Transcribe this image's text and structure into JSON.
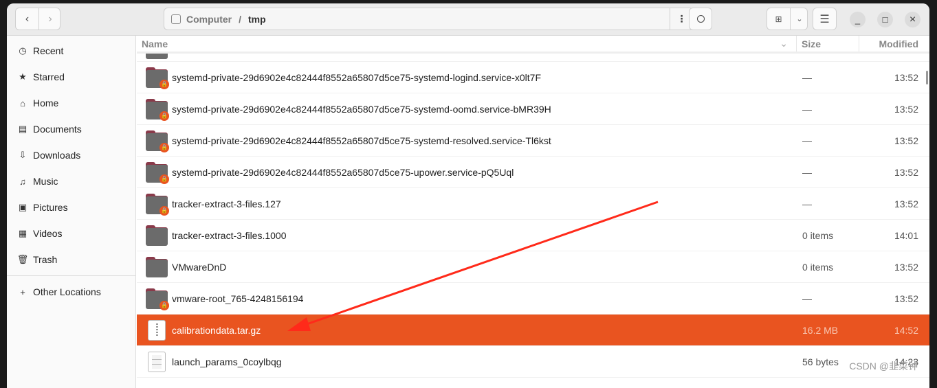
{
  "toolbar": {
    "back_icon": "chevron-left",
    "forward_icon": "chevron-right",
    "path": {
      "root": "Computer",
      "sep": "/",
      "current": "tmp"
    },
    "menu_dots": "⋮",
    "search_icon": "search",
    "view_icon": "grid",
    "view_dropdown": "chevron-down",
    "menu_icon": "hamburger",
    "minimize": "_",
    "maximize": "□",
    "close": "×"
  },
  "sidebar": {
    "items": [
      {
        "icon": "clock",
        "glyph": "◷",
        "label": "Recent"
      },
      {
        "icon": "star",
        "glyph": "★",
        "label": "Starred"
      },
      {
        "icon": "home",
        "glyph": "⌂",
        "label": "Home"
      },
      {
        "icon": "document",
        "glyph": "▤",
        "label": "Documents"
      },
      {
        "icon": "download",
        "glyph": "⇩",
        "label": "Downloads"
      },
      {
        "icon": "music",
        "glyph": "♫",
        "label": "Music"
      },
      {
        "icon": "picture",
        "glyph": "▣",
        "label": "Pictures"
      },
      {
        "icon": "video",
        "glyph": "▦",
        "label": "Videos"
      },
      {
        "icon": "trash",
        "glyph": "🗑",
        "label": "Trash"
      }
    ],
    "other": {
      "glyph": "+",
      "label": "Other Locations"
    }
  },
  "columns": {
    "name": "Name",
    "size": "Size",
    "modified": "Modified"
  },
  "files": [
    {
      "name": "systemd-private-29d6902e4c82444f8552a65807d5ce75-systemd-logind.service-x0lt7F",
      "size": "—",
      "modified": "13:52",
      "type": "locked-folder"
    },
    {
      "name": "systemd-private-29d6902e4c82444f8552a65807d5ce75-systemd-oomd.service-bMR39H",
      "size": "—",
      "modified": "13:52",
      "type": "locked-folder"
    },
    {
      "name": "systemd-private-29d6902e4c82444f8552a65807d5ce75-systemd-resolved.service-Tl6kst",
      "size": "—",
      "modified": "13:52",
      "type": "locked-folder"
    },
    {
      "name": "systemd-private-29d6902e4c82444f8552a65807d5ce75-upower.service-pQ5Uql",
      "size": "—",
      "modified": "13:52",
      "type": "locked-folder"
    },
    {
      "name": "tracker-extract-3-files.127",
      "size": "—",
      "modified": "13:52",
      "type": "locked-folder"
    },
    {
      "name": "tracker-extract-3-files.1000",
      "size": "0 items",
      "modified": "14:01",
      "type": "folder"
    },
    {
      "name": "VMwareDnD",
      "size": "0 items",
      "modified": "13:52",
      "type": "folder"
    },
    {
      "name": "vmware-root_765-4248156194",
      "size": "—",
      "modified": "13:52",
      "type": "locked-folder"
    },
    {
      "name": "calibrationdata.tar.gz",
      "size": "16.2 MB",
      "modified": "14:52",
      "type": "archive",
      "selected": true
    },
    {
      "name": "launch_params_0coylbqg",
      "size": "56 bytes",
      "modified": "14:23",
      "type": "text"
    }
  ],
  "accent": "#e95420",
  "annotation_color": "#ff2a1a",
  "watermark": "CSDN @韭菜钟"
}
